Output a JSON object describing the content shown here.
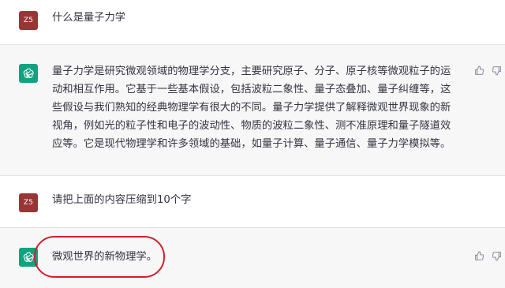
{
  "conversation": {
    "messages": [
      {
        "role": "user",
        "avatar_label": "Z5",
        "text": "什么是量子力学"
      },
      {
        "role": "assistant",
        "avatar_icon": "openai-logo-icon",
        "text": "量子力学是研究微观领域的物理学分支，主要研究原子、分子、原子核等微观粒子的运动和相互作用。它基于一些基本假设，包括波粒二象性、量子态叠加、量子纠缠等，这些假设与我们熟知的经典物理学有很大的不同。量子力学提供了解释微观世界现象的新视角，例如光的粒子性和电子的波动性、物质的波粒二象性、测不准原理和量子隧道效应等。它是现代物理学和许多领域的基础，如量子计算、量子通信、量子力学模拟等。",
        "actions": [
          "thumbs-up-icon",
          "thumbs-down-icon"
        ]
      },
      {
        "role": "user",
        "avatar_label": "Z5",
        "text": "请把上面的内容压缩到10个字"
      },
      {
        "role": "assistant",
        "avatar_icon": "openai-logo-icon",
        "text": "微观世界的新物理学。",
        "actions": [
          "thumbs-up-icon",
          "thumbs-down-icon"
        ],
        "highlighted": true
      }
    ]
  },
  "colors": {
    "user_avatar_bg": "#9a3535",
    "assistant_avatar_bg": "#10a37f",
    "assistant_row_bg": "#f7f7f8",
    "highlight_ring": "#d11f2a"
  }
}
